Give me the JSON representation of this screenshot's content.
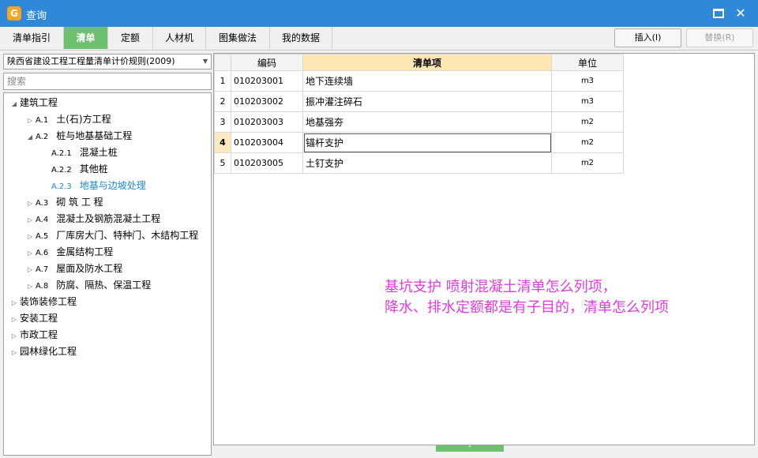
{
  "window": {
    "title": "查询"
  },
  "tabs": [
    {
      "label": "清单指引",
      "active": false
    },
    {
      "label": "清单",
      "active": true
    },
    {
      "label": "定额",
      "active": false
    },
    {
      "label": "人材机",
      "active": false
    },
    {
      "label": "图集做法",
      "active": false
    },
    {
      "label": "我的数据",
      "active": false
    }
  ],
  "toolbar": {
    "insert_label": "插入(I)",
    "replace_label": "替换(R)"
  },
  "left": {
    "rule_select": "陕西省建设工程工程量清单计价规则(2009)",
    "search_placeholder": "搜索"
  },
  "tree": [
    {
      "code": "",
      "label": "建筑工程",
      "glyph": "◢",
      "level": 0
    },
    {
      "code": "A.1",
      "label": "土(石)方工程",
      "glyph": "▷",
      "level": 1
    },
    {
      "code": "A.2",
      "label": "桩与地基基础工程",
      "glyph": "◢",
      "level": 1
    },
    {
      "code": "A.2.1",
      "label": "混凝土桩",
      "glyph": "",
      "level": 2
    },
    {
      "code": "A.2.2",
      "label": "其他桩",
      "glyph": "",
      "level": 2
    },
    {
      "code": "A.2.3",
      "label": "地基与边坡处理",
      "glyph": "",
      "level": 2,
      "selected": true
    },
    {
      "code": "A.3",
      "label": "砌 筑 工 程",
      "glyph": "▷",
      "level": 1
    },
    {
      "code": "A.4",
      "label": "混凝土及钢筋混凝土工程",
      "glyph": "▷",
      "level": 1
    },
    {
      "code": "A.5",
      "label": "厂库房大门、特种门、木结构工程",
      "glyph": "▷",
      "level": 1
    },
    {
      "code": "A.6",
      "label": "金属结构工程",
      "glyph": "▷",
      "level": 1
    },
    {
      "code": "A.7",
      "label": "屋面及防水工程",
      "glyph": "▷",
      "level": 1
    },
    {
      "code": "A.8",
      "label": "防腐、隔热、保温工程",
      "glyph": "▷",
      "level": 1
    },
    {
      "code": "",
      "label": "装饰装修工程",
      "glyph": "▷",
      "level": 0
    },
    {
      "code": "",
      "label": "安装工程",
      "glyph": "▷",
      "level": 0
    },
    {
      "code": "",
      "label": "市政工程",
      "glyph": "▷",
      "level": 0
    },
    {
      "code": "",
      "label": "园林绿化工程",
      "glyph": "▷",
      "level": 0
    }
  ],
  "grid": {
    "headers": {
      "code": "编码",
      "item": "清单项",
      "unit": "单位"
    },
    "rows": [
      {
        "no": "1",
        "code": "010203001",
        "item": "地下连续墙",
        "unit": "m3"
      },
      {
        "no": "2",
        "code": "010203002",
        "item": "振冲灌注碎石",
        "unit": "m3"
      },
      {
        "no": "3",
        "code": "010203003",
        "item": "地基强夯",
        "unit": "m2"
      },
      {
        "no": "4",
        "code": "010203004",
        "item": "锚杆支护",
        "unit": "m2",
        "current": true
      },
      {
        "no": "5",
        "code": "010203005",
        "item": "土钉支护",
        "unit": "m2"
      }
    ]
  },
  "annotation": {
    "line1": "基坑支护 喷射混凝土清单怎么列项，",
    "line2": "降水、排水定额都是有子目的，清单怎么列项"
  },
  "colors": {
    "title_bar": "#2f88d8",
    "active_tab": "#6dc06d",
    "selected_tree": "#1e88d2",
    "annotation": "#e03ce0"
  }
}
